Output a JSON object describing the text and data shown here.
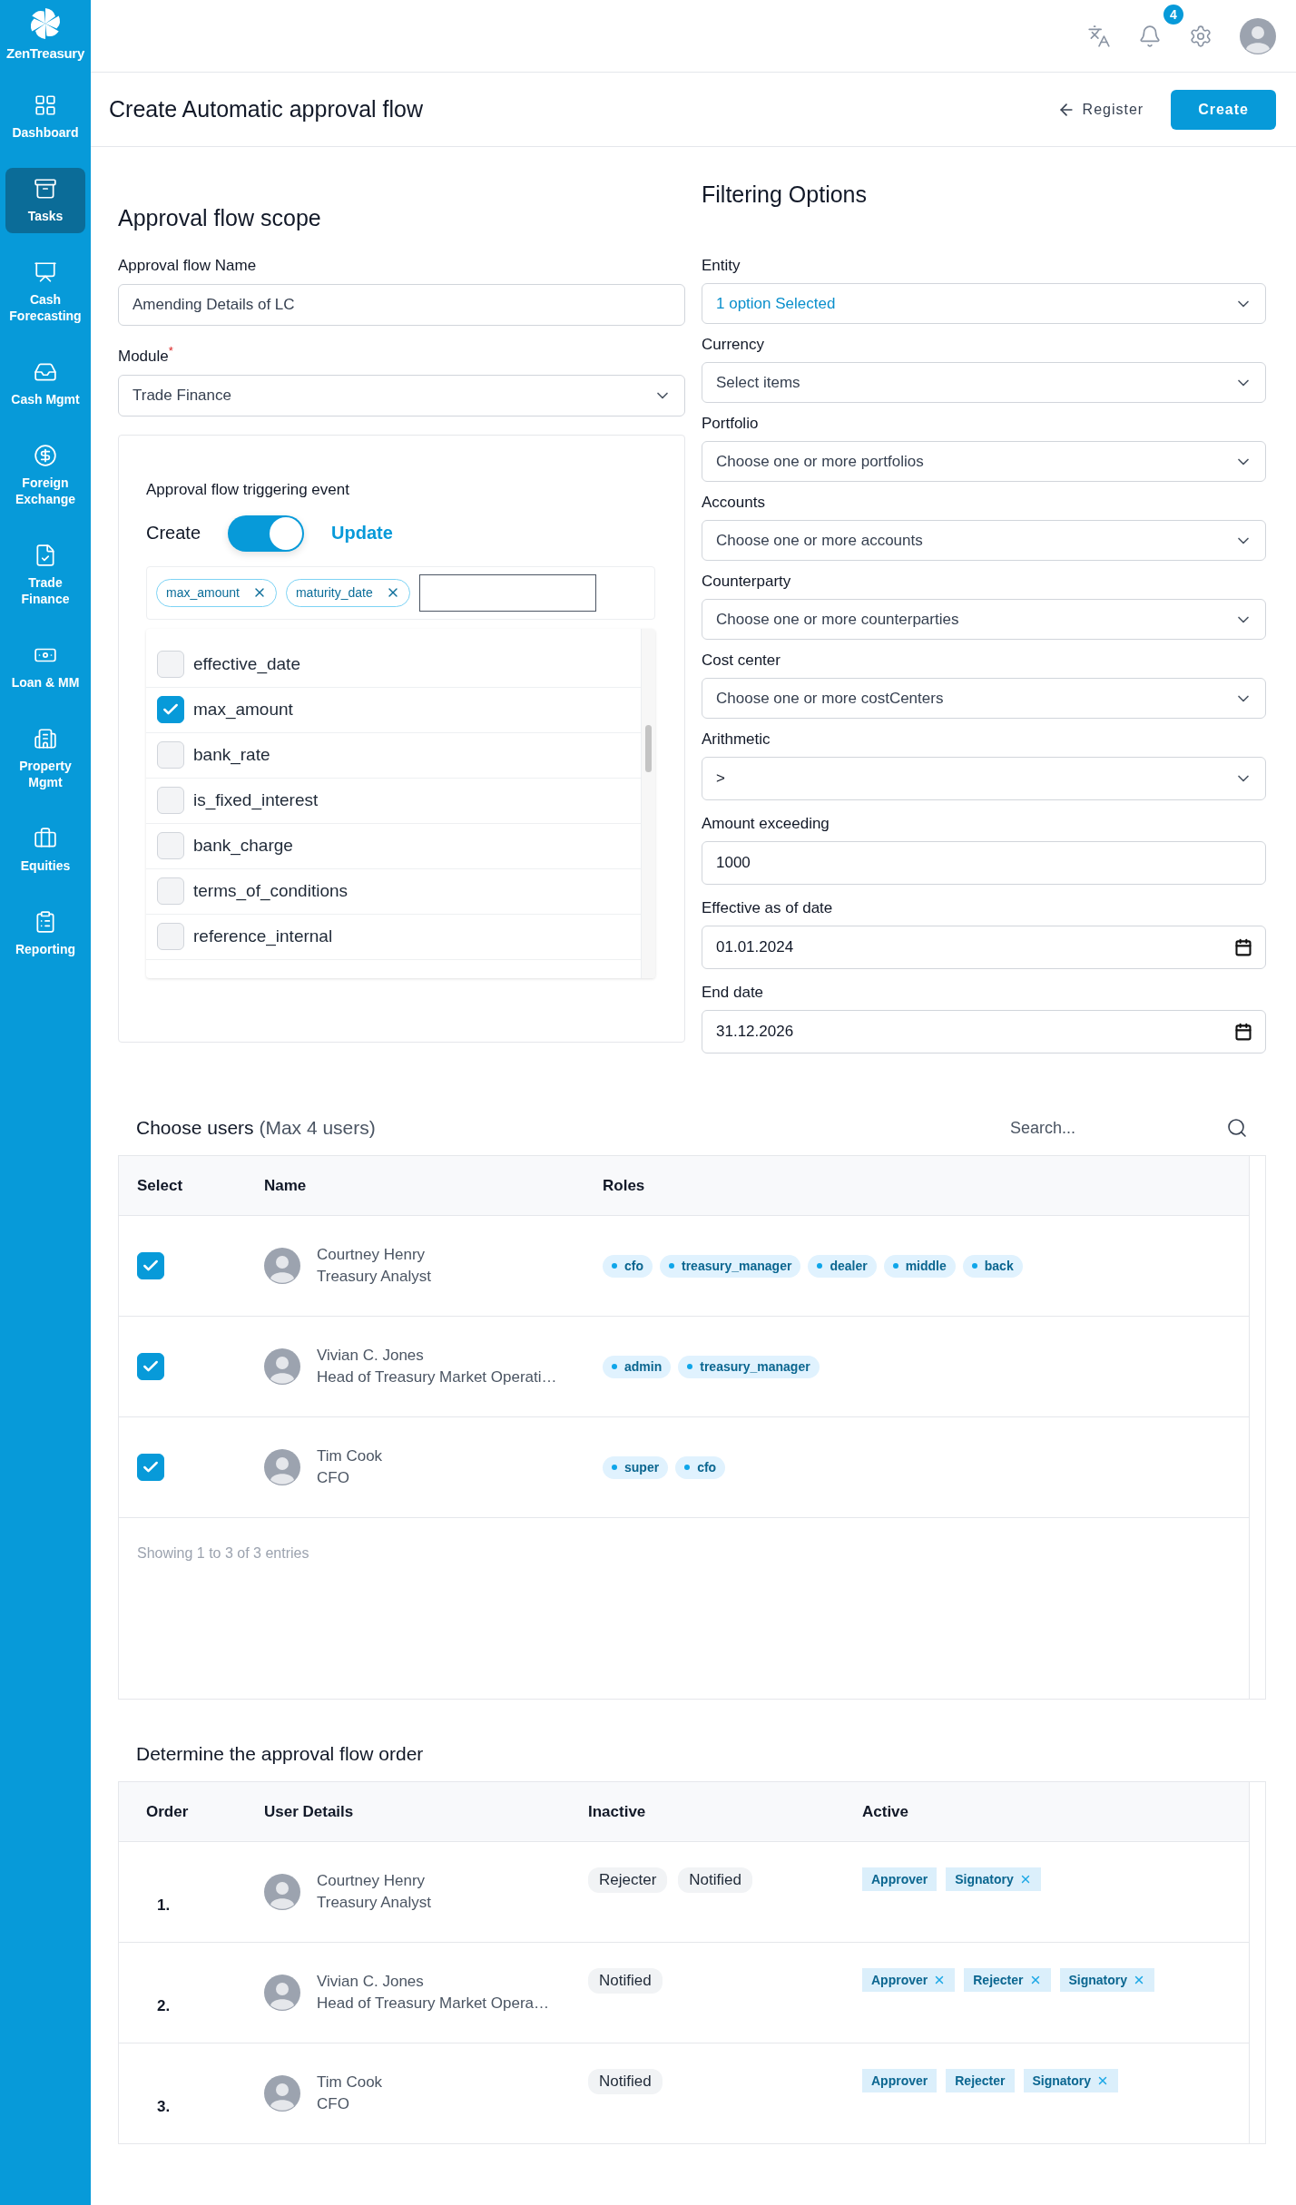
{
  "sidebar": {
    "brand": "ZenTreasury",
    "items": [
      {
        "label": "Dashboard",
        "selected": false
      },
      {
        "label": "Tasks",
        "selected": true
      },
      {
        "label": "Cash Forecasting",
        "selected": false
      },
      {
        "label": "Cash Mgmt",
        "selected": false
      },
      {
        "label": "Foreign Exchange",
        "selected": false
      },
      {
        "label": "Trade Finance",
        "selected": false
      },
      {
        "label": "Loan & MM",
        "selected": false
      },
      {
        "label": "Property Mgmt",
        "selected": false
      },
      {
        "label": "Equities",
        "selected": false
      },
      {
        "label": "Reporting",
        "selected": false
      }
    ]
  },
  "header": {
    "notification_count": "4"
  },
  "page": {
    "title": "Create Automatic approval flow",
    "back_link": "Register",
    "submit_button": "Create"
  },
  "scope": {
    "title": "Approval flow scope",
    "name_field": {
      "label": "Approval flow Name",
      "value": "Amending Details of LC"
    },
    "module_field": {
      "label": "Module",
      "required_mark": "*",
      "value": "Trade Finance"
    },
    "trigger": {
      "title": "Approval flow triggering event",
      "left_label": "Create",
      "right_label": "Update",
      "on": true,
      "tags": [
        "max_amount",
        "maturity_date"
      ],
      "options": [
        {
          "label": "effective_date",
          "checked": false
        },
        {
          "label": "max_amount",
          "checked": true
        },
        {
          "label": "bank_rate",
          "checked": false
        },
        {
          "label": "is_fixed_interest",
          "checked": false
        },
        {
          "label": "bank_charge",
          "checked": false
        },
        {
          "label": "terms_of_conditions",
          "checked": false
        },
        {
          "label": "reference_internal",
          "checked": false
        }
      ]
    }
  },
  "filters": {
    "title": "Filtering Options",
    "fields": [
      {
        "label": "Entity",
        "kind": "multiselect",
        "value": "1 option Selected"
      },
      {
        "label": "Currency",
        "kind": "select",
        "placeholder": "Select items"
      },
      {
        "label": "Portfolio",
        "kind": "select",
        "placeholder": "Choose one or more portfolios"
      },
      {
        "label": "Accounts",
        "kind": "select",
        "placeholder": "Choose one or more accounts"
      },
      {
        "label": "Counterparty",
        "kind": "select",
        "placeholder": "Choose one or more counterparties"
      },
      {
        "label": "Cost center",
        "kind": "select",
        "placeholder": "Choose one or more costCenters"
      },
      {
        "label": "Arithmetic",
        "kind": "select",
        "value": ">"
      },
      {
        "label": "Amount exceeding",
        "kind": "input",
        "value": "1000"
      },
      {
        "label": "Effective as of date",
        "kind": "date",
        "value": "01.01.2024"
      },
      {
        "label": "End date",
        "kind": "date",
        "value": "31.12.2026"
      }
    ]
  },
  "users": {
    "title": "Choose users",
    "title_note": "(Max 4 users)",
    "search_placeholder": "Search...",
    "columns": [
      "Select",
      "Name",
      "Roles"
    ],
    "rows": [
      {
        "selected": true,
        "name": "Courtney Henry",
        "subtitle": "Treasury Analyst",
        "roles": [
          "cfo",
          "treasury_manager",
          "dealer",
          "middle",
          "back"
        ]
      },
      {
        "selected": true,
        "name": "Vivian C. Jones",
        "subtitle": "Head of Treasury Market Operati…",
        "roles": [
          "admin",
          "treasury_manager"
        ]
      },
      {
        "selected": true,
        "name": "Tim Cook",
        "subtitle": "CFO",
        "roles": [
          "super",
          "cfo"
        ]
      }
    ],
    "footer": "Showing 1 to 3 of 3 entries"
  },
  "order": {
    "title": "Determine the approval flow order",
    "columns": [
      "Order",
      "User Details",
      "Inactive",
      "Active"
    ],
    "rows": [
      {
        "order": "1.",
        "name": "Courtney Henry",
        "subtitle": "Treasury Analyst",
        "inactive": [
          "Rejecter",
          "Notified"
        ],
        "active": [
          {
            "label": "Approver",
            "removable": false
          },
          {
            "label": "Signatory",
            "removable": true
          }
        ]
      },
      {
        "order": "2.",
        "name": "Vivian C. Jones",
        "subtitle": "Head of Treasury Market Opera…",
        "inactive": [
          "Notified"
        ],
        "active": [
          {
            "label": "Approver",
            "removable": true
          },
          {
            "label": "Rejecter",
            "removable": true
          },
          {
            "label": "Signatory",
            "removable": true
          }
        ]
      },
      {
        "order": "3.",
        "name": "Tim Cook",
        "subtitle": "CFO",
        "inactive": [
          "Notified"
        ],
        "active": [
          {
            "label": "Approver",
            "removable": false
          },
          {
            "label": "Rejecter",
            "removable": false
          },
          {
            "label": "Signatory",
            "removable": true
          }
        ]
      }
    ]
  }
}
